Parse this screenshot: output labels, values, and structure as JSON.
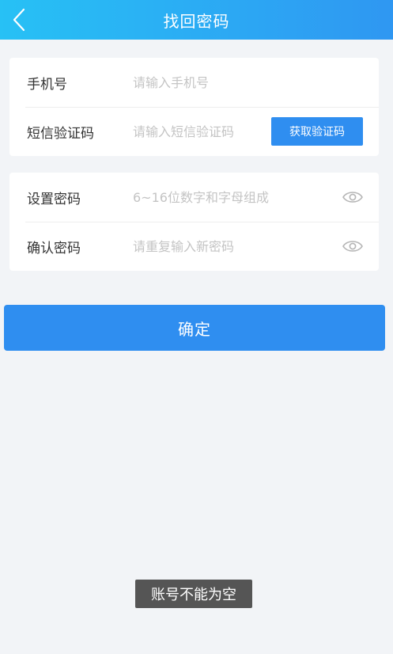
{
  "header": {
    "title": "找回密码",
    "back_icon": "chevron-left-icon"
  },
  "verify_card": {
    "phone": {
      "label": "手机号",
      "value": "",
      "placeholder": "请输入手机号"
    },
    "sms": {
      "label": "短信验证码",
      "value": "",
      "placeholder": "请输入短信验证码",
      "button_label": "获取验证码"
    }
  },
  "password_card": {
    "set_password": {
      "label": "设置密码",
      "value": "",
      "placeholder": "6~16位数字和字母组成",
      "toggle_icon": "eye-icon"
    },
    "confirm_password": {
      "label": "确认密码",
      "value": "",
      "placeholder": "请重复输入新密码",
      "toggle_icon": "eye-icon"
    }
  },
  "submit": {
    "label": "确定"
  },
  "toast": {
    "message": "账号不能为空"
  },
  "colors": {
    "header_gradient_start": "#27c1f5",
    "header_gradient_end": "#2f97f2",
    "primary_button": "#2f8ef0",
    "background": "#f2f4f7",
    "toast_background": "#555555"
  }
}
